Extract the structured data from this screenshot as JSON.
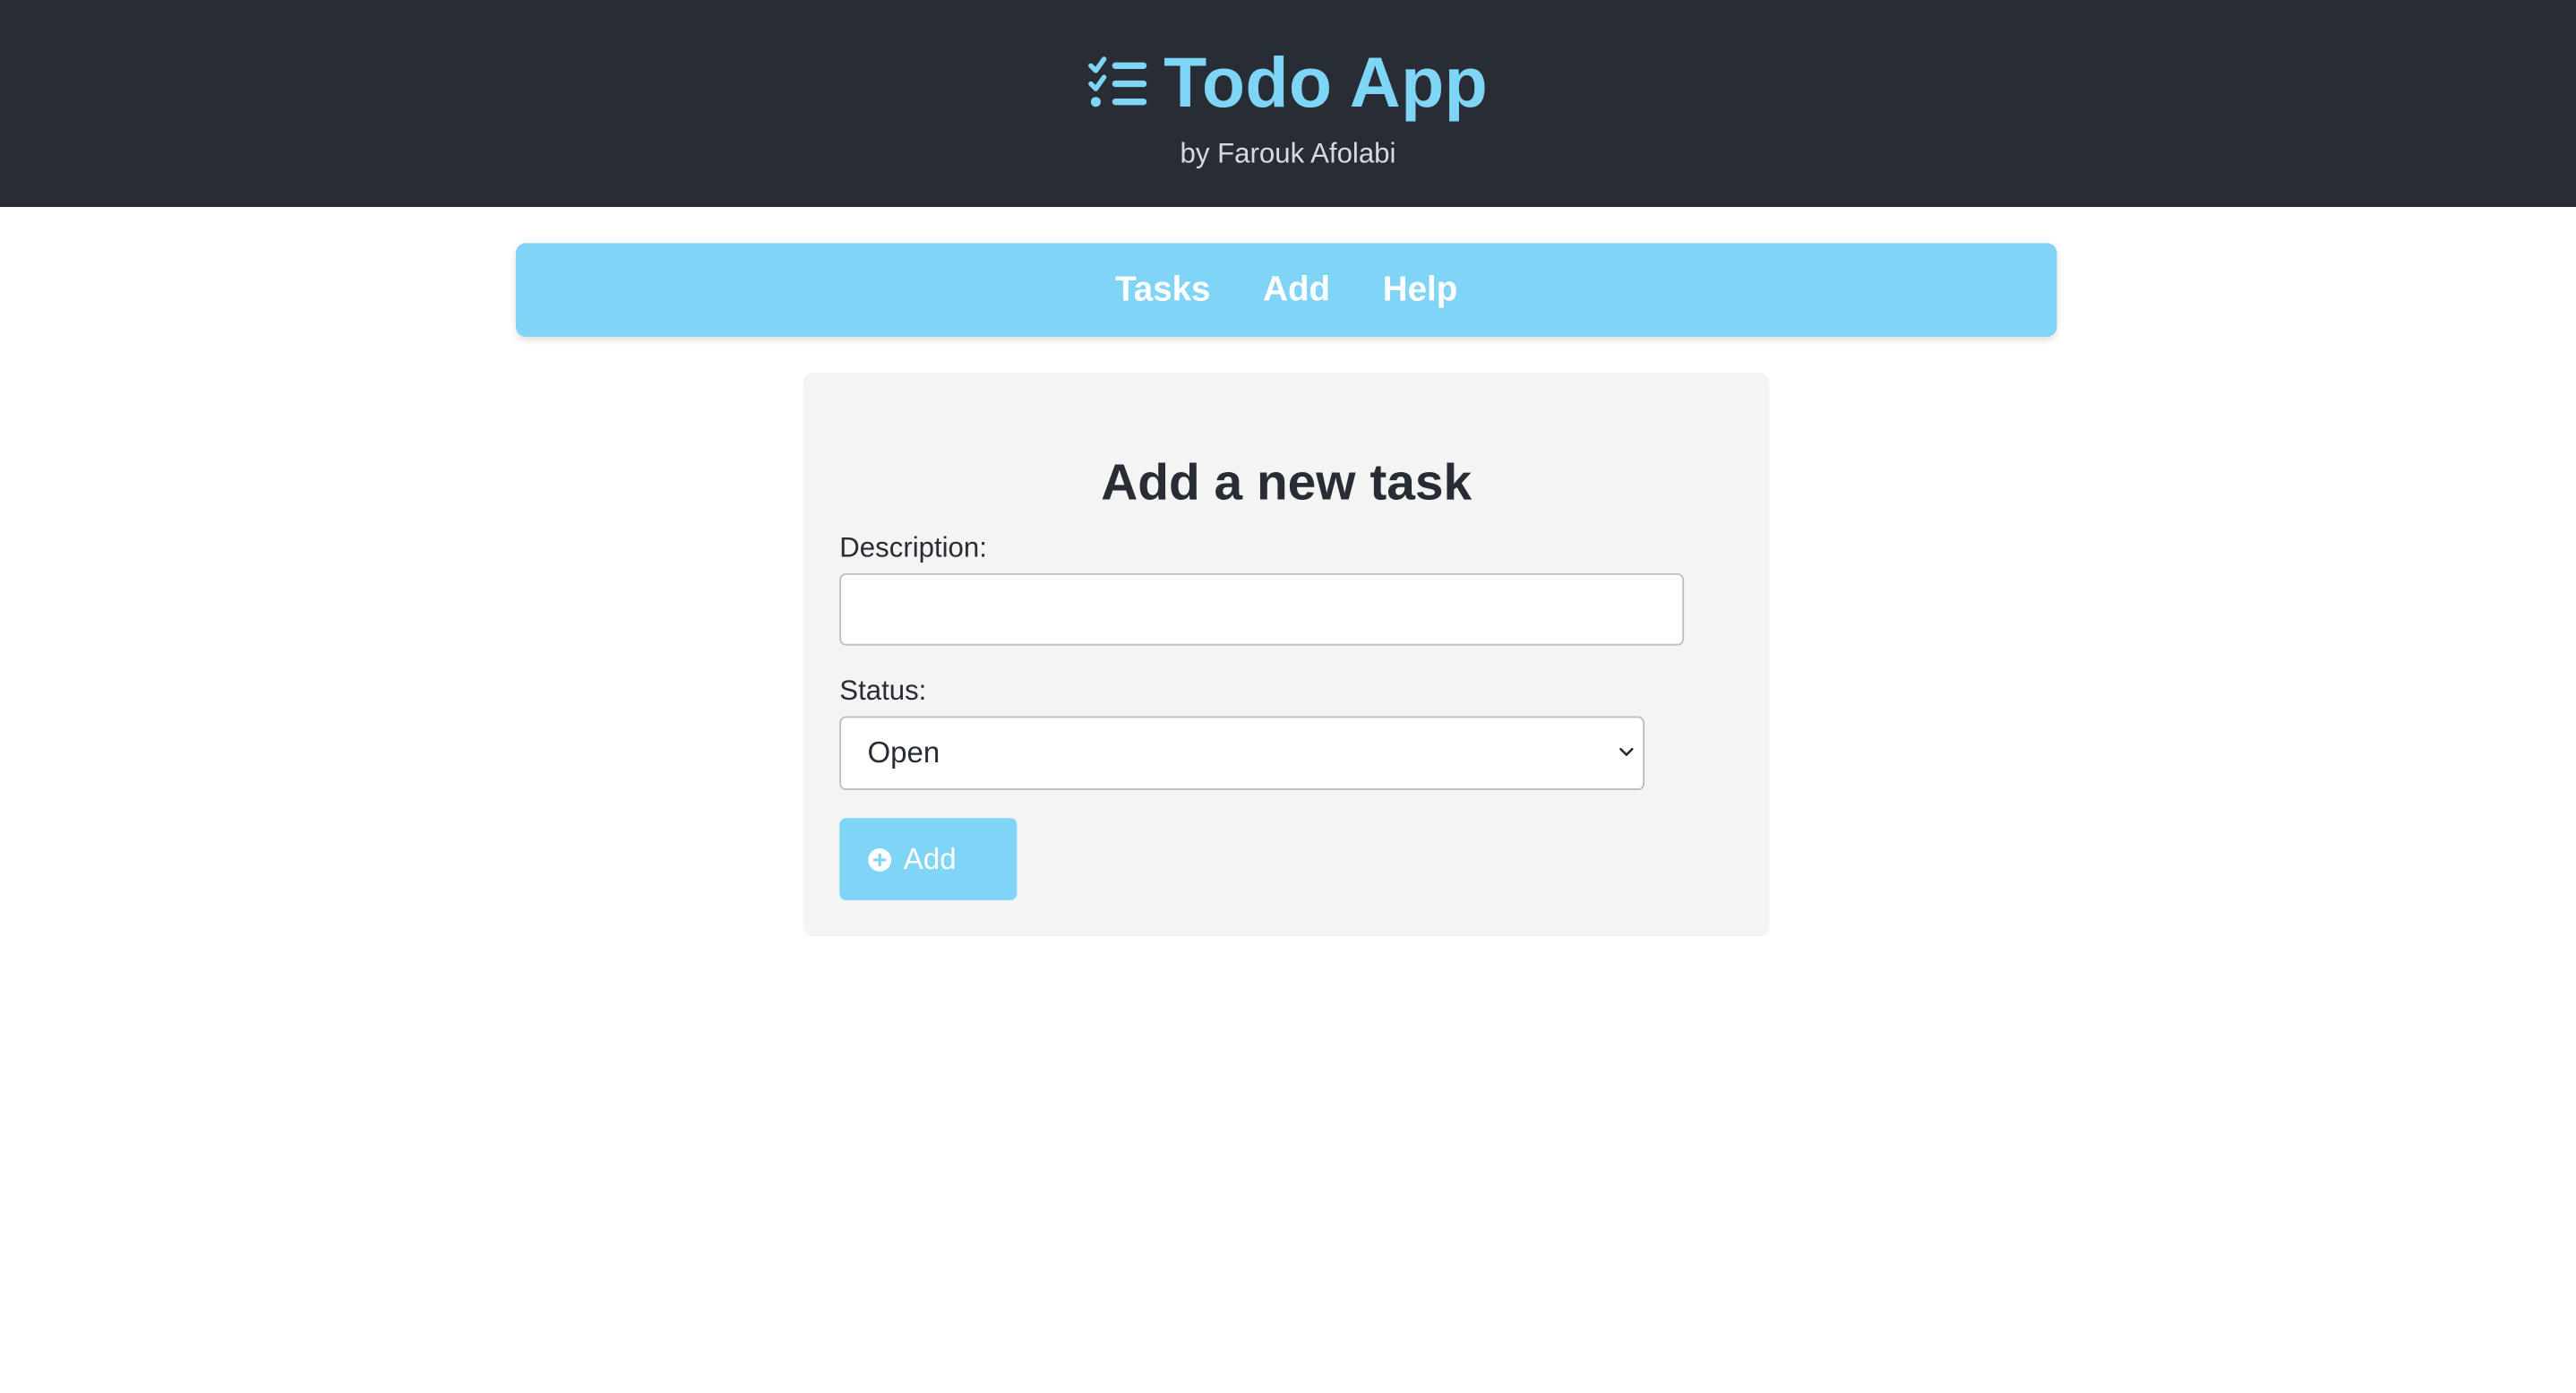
{
  "header": {
    "title": "Todo App",
    "subtitle": "by Farouk Afolabi",
    "icon": "task-list-icon"
  },
  "nav": {
    "items": [
      {
        "label": "Tasks"
      },
      {
        "label": "Add"
      },
      {
        "label": "Help"
      }
    ]
  },
  "form": {
    "heading": "Add a new task",
    "description_label": "Description:",
    "description_value": "",
    "status_label": "Status:",
    "status_selected": "Open",
    "submit_label": "Add",
    "submit_icon": "plus-circle-icon"
  },
  "colors": {
    "header_bg": "#282c34",
    "accent": "#80d5f6",
    "card_bg": "#f4f4f4"
  }
}
